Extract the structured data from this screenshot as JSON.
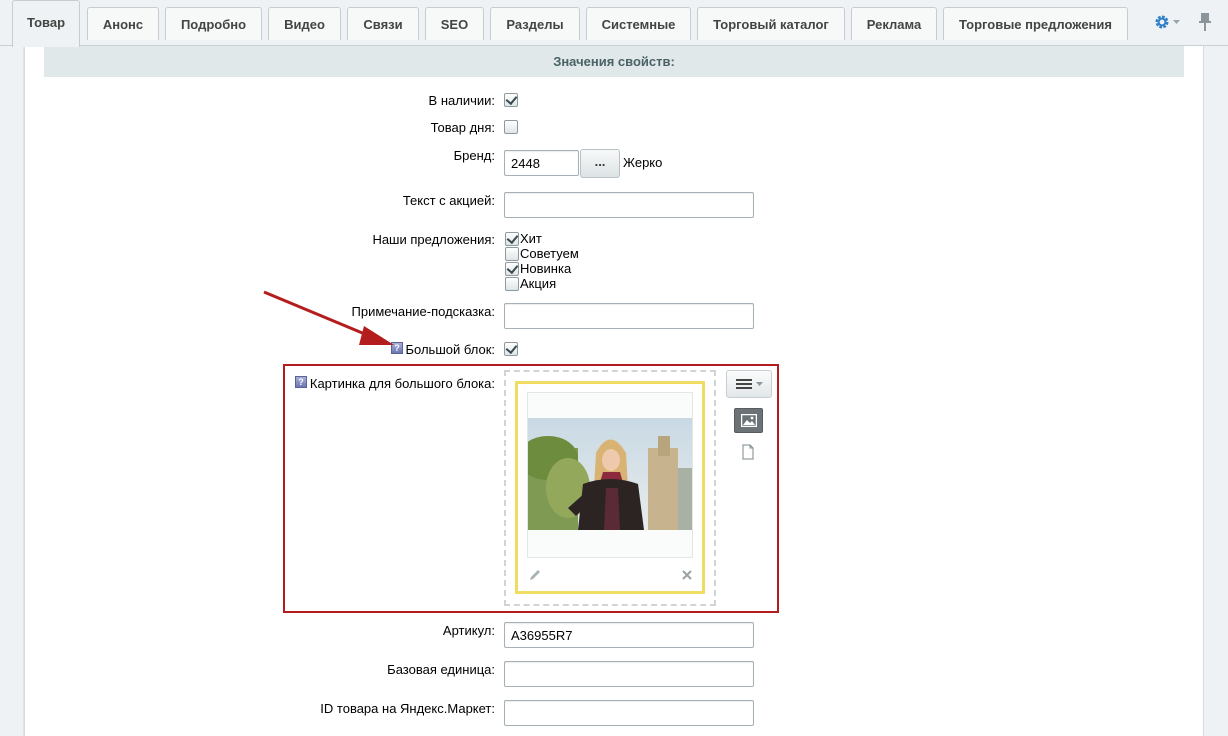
{
  "tabs": [
    "Товар",
    "Анонс",
    "Подробно",
    "Видео",
    "Связи",
    "SEO",
    "Разделы",
    "Системные",
    "Торговый каталог",
    "Реклама",
    "Торговые предложения"
  ],
  "active_tab": "Товар",
  "section_title": "Значения свойств:",
  "fields": {
    "in_stock": {
      "label": "В наличии:",
      "checked": true
    },
    "product_of_day": {
      "label": "Товар дня:",
      "checked": false
    },
    "brand": {
      "label": "Бренд:",
      "value": "2448",
      "button_label": "...",
      "name": "Жерко"
    },
    "promo_text": {
      "label": "Текст с акцией:",
      "value": ""
    },
    "offers": {
      "label": "Наши предложения:",
      "options": [
        {
          "label": "Хит",
          "checked": true
        },
        {
          "label": "Советуем",
          "checked": false
        },
        {
          "label": "Новинка",
          "checked": true
        },
        {
          "label": "Акция",
          "checked": false
        }
      ]
    },
    "hint_note": {
      "label": "Примечание-подсказка:",
      "value": ""
    },
    "big_block": {
      "label": "Большой блок:",
      "checked": true,
      "help_glyph": "?"
    },
    "big_block_image": {
      "label": "Картинка для большого блока:",
      "help_glyph": "?"
    },
    "article": {
      "label": "Артикул:",
      "value": "A36955R7"
    },
    "base_unit": {
      "label": "Базовая единица:",
      "value": ""
    },
    "yandex_id": {
      "label": "ID товара на Яндекс.Маркет:",
      "value": ""
    }
  },
  "icons": {
    "settings": "gear-icon",
    "pin": "pin-icon",
    "menu": "hamburger-menu-icon",
    "image_mode": "image-icon",
    "file_mode": "file-icon",
    "edit": "pencil-icon",
    "delete": "close-icon"
  },
  "colors": {
    "highlight_border": "#b31d1d",
    "image_card_border": "#f1dc63",
    "gear_blue": "#2f7fc9"
  }
}
